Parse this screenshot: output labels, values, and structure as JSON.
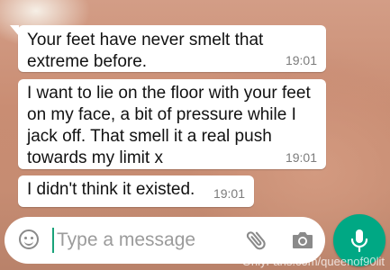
{
  "messages": [
    {
      "text": "Your feet have never smelt that extreme before.",
      "time": "19:01"
    },
    {
      "text": "I want to lie on the floor with your feet on my face, a bit of pressure while I jack off. That smell it a real push towards my limit x",
      "time": "19:01"
    },
    {
      "text": "I didn't think it existed.",
      "time": "19:01"
    }
  ],
  "composer": {
    "placeholder": "Type a message",
    "icons": [
      "emoji-icon",
      "attach-paperclip-icon",
      "camera-icon",
      "microphone-icon"
    ]
  },
  "colors": {
    "bubble": "#ffffff",
    "accent": "#00a884",
    "time_text": "#7c7c7c"
  },
  "watermark": "OnlyFans.com/queenof90lit"
}
